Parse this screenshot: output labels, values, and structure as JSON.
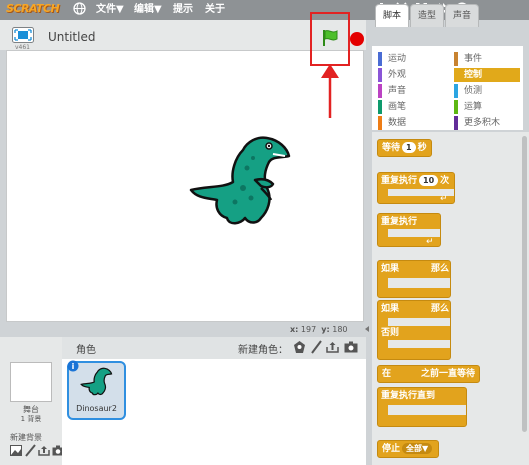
{
  "topbar": {
    "logo_text": "SCRATCH",
    "menus": [
      "文件▼",
      "编辑▼",
      "提示",
      "关于"
    ],
    "tool_icons": [
      "globe-icon",
      "stamp-icon",
      "scissors-icon",
      "grow-icon",
      "shrink-icon",
      "help-icon"
    ]
  },
  "stage": {
    "project_title": "Untitled",
    "version": "v461",
    "coords": {
      "x_label": "x:",
      "x_value": "197",
      "y_label": "y:",
      "y_value": "180"
    }
  },
  "sprites": {
    "header_label": "角色",
    "new_sprite_label": "新建角色：",
    "sprite_name": "Dinosaur2",
    "stage_label": "舞台",
    "stage_backdrop_count": "1 背景",
    "new_backdrop_label": "新建背景"
  },
  "palette": {
    "tabs": [
      "脚本",
      "造型",
      "声音"
    ],
    "categories_left": [
      {
        "label": "运动",
        "color": "#4a6cd4"
      },
      {
        "label": "外观",
        "color": "#8a55d7"
      },
      {
        "label": "声音",
        "color": "#bb42c3"
      },
      {
        "label": "画笔",
        "color": "#0e9a6c"
      },
      {
        "label": "数据",
        "color": "#ee7d16"
      }
    ],
    "categories_right": [
      {
        "label": "事件",
        "color": "#c88330"
      },
      {
        "label": "控制",
        "color": "#e1a91a"
      },
      {
        "label": "侦测",
        "color": "#2ca5e2"
      },
      {
        "label": "运算",
        "color": "#5cb712"
      },
      {
        "label": "更多积木",
        "color": "#632d99"
      }
    ],
    "selected_category": "控制",
    "blocks": {
      "wait": "等待",
      "wait_value": "1",
      "wait_unit": "秒",
      "repeat": "重复执行",
      "repeat_value": "10",
      "repeat_unit": "次",
      "forever": "重复执行",
      "if": "如果",
      "then": "那么",
      "if2": "如果",
      "then2": "那么",
      "else": "否则",
      "wait_until_prefix": "在",
      "wait_until_suffix": "之前一直等待",
      "repeat_until": "重复执行直到",
      "stop": "停止",
      "stop_value": "全部▼"
    }
  },
  "colors": {
    "control": "#e2a31d",
    "stop_red": "#e40000",
    "flag_green": "#4cbf2a",
    "annotation_red": "#e22222"
  }
}
